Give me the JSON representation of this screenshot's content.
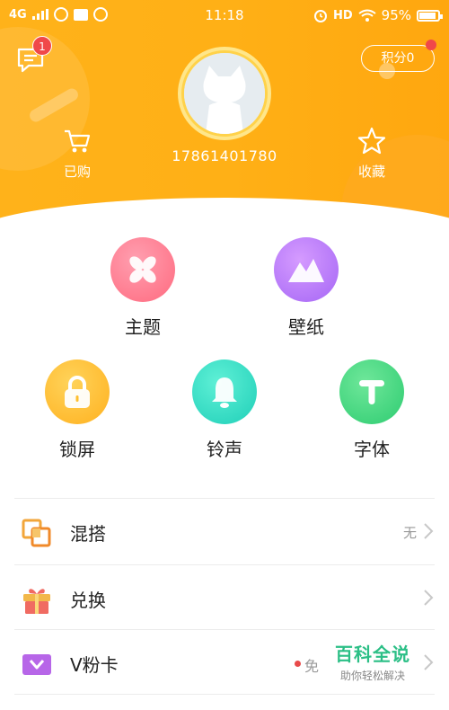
{
  "status_bar": {
    "network": "4G",
    "time": "11:18",
    "hd": "HD",
    "battery": "95%"
  },
  "header": {
    "message_badge": "1",
    "points_label": "积分0",
    "phone": "17861401780",
    "purchased_label": "已购",
    "favorites_label": "收藏"
  },
  "grid": [
    {
      "label": "主题",
      "icon": "flower-icon"
    },
    {
      "label": "壁纸",
      "icon": "mountain-icon"
    },
    {
      "label": "锁屏",
      "icon": "lock-icon"
    },
    {
      "label": "铃声",
      "icon": "bell-icon"
    },
    {
      "label": "字体",
      "icon": "letter-t-icon"
    }
  ],
  "list": [
    {
      "title": "混搭",
      "value": "无",
      "icon": "mix-icon"
    },
    {
      "title": "兑换",
      "value": "",
      "icon": "gift-icon"
    },
    {
      "title": "V粉卡",
      "value": "免",
      "icon": "card-icon"
    }
  ],
  "watermark": {
    "title": "百科全说",
    "subtitle": "助你轻松解决"
  },
  "colors": {
    "header": "#ffb016",
    "badge": "#f0484a",
    "watermark": "#2bbf86"
  }
}
